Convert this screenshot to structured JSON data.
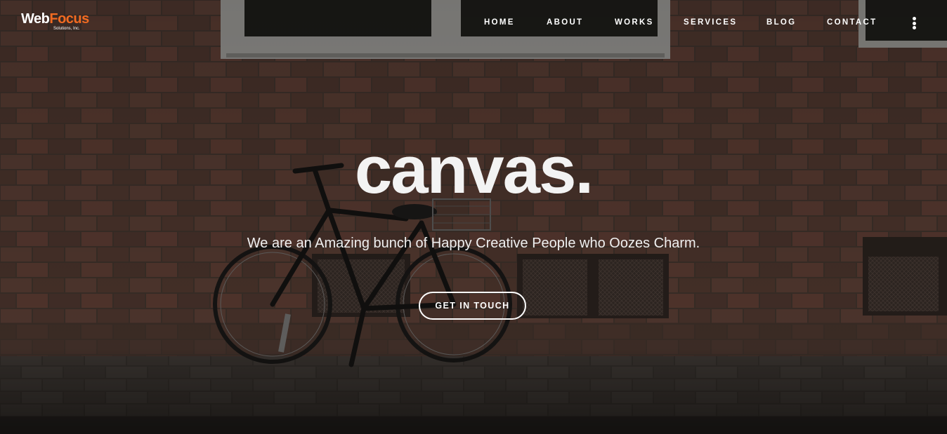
{
  "brand": {
    "logo_word_1": "Web",
    "logo_word_2": "Focus",
    "logo_tagline": "Solutions, Inc.",
    "accent_color": "#f26b21"
  },
  "nav": {
    "items": [
      {
        "label": "HOME"
      },
      {
        "label": "ABOUT"
      },
      {
        "label": "WORKS"
      },
      {
        "label": "SERVICES"
      },
      {
        "label": "BLOG"
      },
      {
        "label": "CONTACT"
      }
    ],
    "menu_icon": "vertical-dots-icon"
  },
  "hero": {
    "title": "canvas.",
    "subtitle": "We are an Amazing bunch of Happy Creative People who Oozes Charm.",
    "cta_label": "GET IN TOUCH",
    "background_image": "bicycle-against-brick-wall"
  }
}
